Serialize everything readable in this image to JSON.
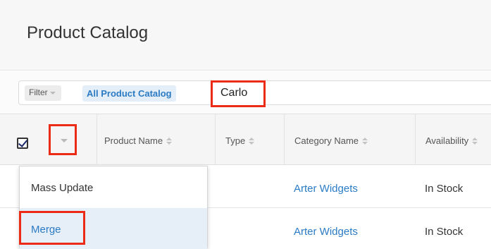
{
  "header": {
    "title": "Product Catalog"
  },
  "filter": {
    "dropdown_label": "Filter",
    "chip_label": "All Product Catalog",
    "search_value": "Carlo"
  },
  "columns": [
    {
      "label": "Product Name",
      "sortable": true
    },
    {
      "label": "Type",
      "sortable": true
    },
    {
      "label": "Category Name",
      "sortable": true
    },
    {
      "label": "Availability",
      "sortable": true
    }
  ],
  "rows": [
    {
      "category": "Arter Widgets",
      "availability": "In Stock"
    },
    {
      "category": "Arter Widgets",
      "availability": "In Stock"
    }
  ],
  "actions_menu": {
    "items": [
      {
        "label": "Mass Update"
      },
      {
        "label": "Merge"
      }
    ]
  },
  "colors": {
    "accent": "#2b7bc4",
    "highlight_box": "#ec2b17",
    "menu_hover": "#e6eef7"
  }
}
